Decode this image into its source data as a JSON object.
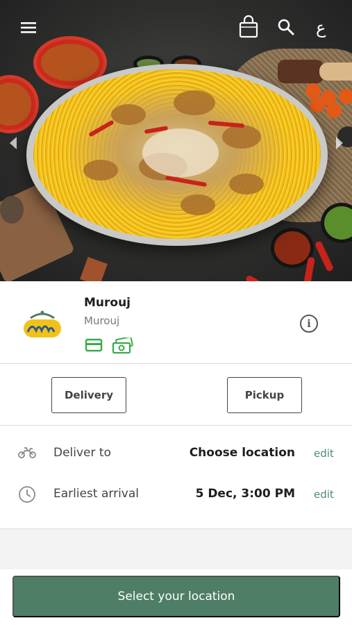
{
  "header": {
    "menu_icon": "hamburger-menu-icon",
    "cart_icon": "shopping-bag-icon",
    "search_icon": "search-icon",
    "language_toggle": "ع"
  },
  "hero": {
    "prev_icon": "chevron-left-icon",
    "next_icon": "chevron-right-icon"
  },
  "restaurant": {
    "name": "Murouj",
    "subtitle": "Murouj",
    "logo_icon": "murouj-logo",
    "payment_icons": [
      "credit-card-icon",
      "cash-icon"
    ],
    "info_icon": "info-icon",
    "info_glyph": "i"
  },
  "order_mode": {
    "delivery_label": "Delivery",
    "pickup_label": "Pickup"
  },
  "details": {
    "deliver_to": {
      "icon": "motorbike-icon",
      "label": "Deliver to",
      "value": "Choose location",
      "edit": "edit"
    },
    "arrival": {
      "icon": "clock-icon",
      "label": "Earliest arrival",
      "value": "5 Dec, 3:00 PM",
      "edit": "edit"
    }
  },
  "footer": {
    "cta_label": "Select your location"
  },
  "colors": {
    "accent": "#4e7e66",
    "edit_link": "#4a8a72",
    "payment_green": "#3aaa4a"
  }
}
